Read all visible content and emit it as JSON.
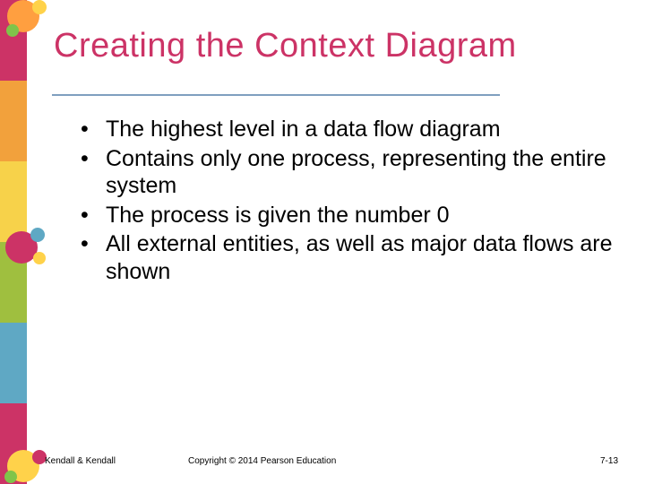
{
  "title": "Creating the Context Diagram",
  "bullets": [
    "The highest level in a data flow diagram",
    "Contains only one process, representing the entire system",
    "The process is given the number 0",
    "All external entities, as well as major data flows are shown"
  ],
  "footer": {
    "authors": "Kendall & Kendall",
    "copyright": "Copyright © 2014 Pearson Education",
    "pagenum": "7-13"
  },
  "stripe_colors": [
    "#cc3366",
    "#f2a13c",
    "#f7d24a",
    "#9fbf3f",
    "#5fa8c4",
    "#cc3366"
  ],
  "dot_colors": {
    "top": {
      "big": "#ff9f40",
      "small1": "#ffd24a",
      "small2": "#7fc44a"
    },
    "mid": {
      "big": "#cc3366",
      "small1": "#5fa8c4",
      "small2": "#ffd24a"
    },
    "bottom": {
      "big": "#ffd24a",
      "small1": "#cc3366",
      "small2": "#7fc44a"
    }
  }
}
